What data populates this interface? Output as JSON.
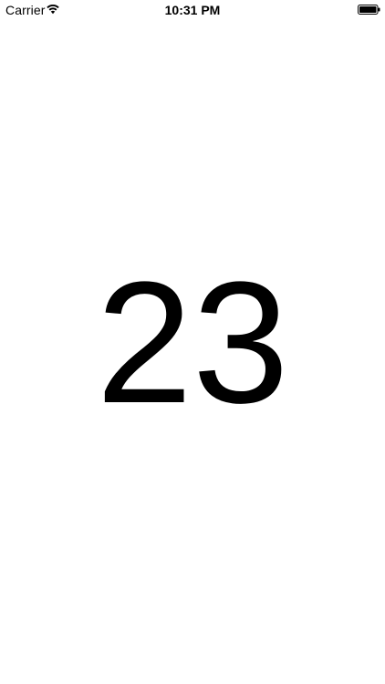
{
  "status_bar": {
    "carrier": "Carrier",
    "time": "10:31 PM",
    "wifi_icon": "wifi-icon",
    "battery_icon": "battery-icon",
    "battery_level": 1.0
  },
  "main": {
    "number": "23"
  }
}
